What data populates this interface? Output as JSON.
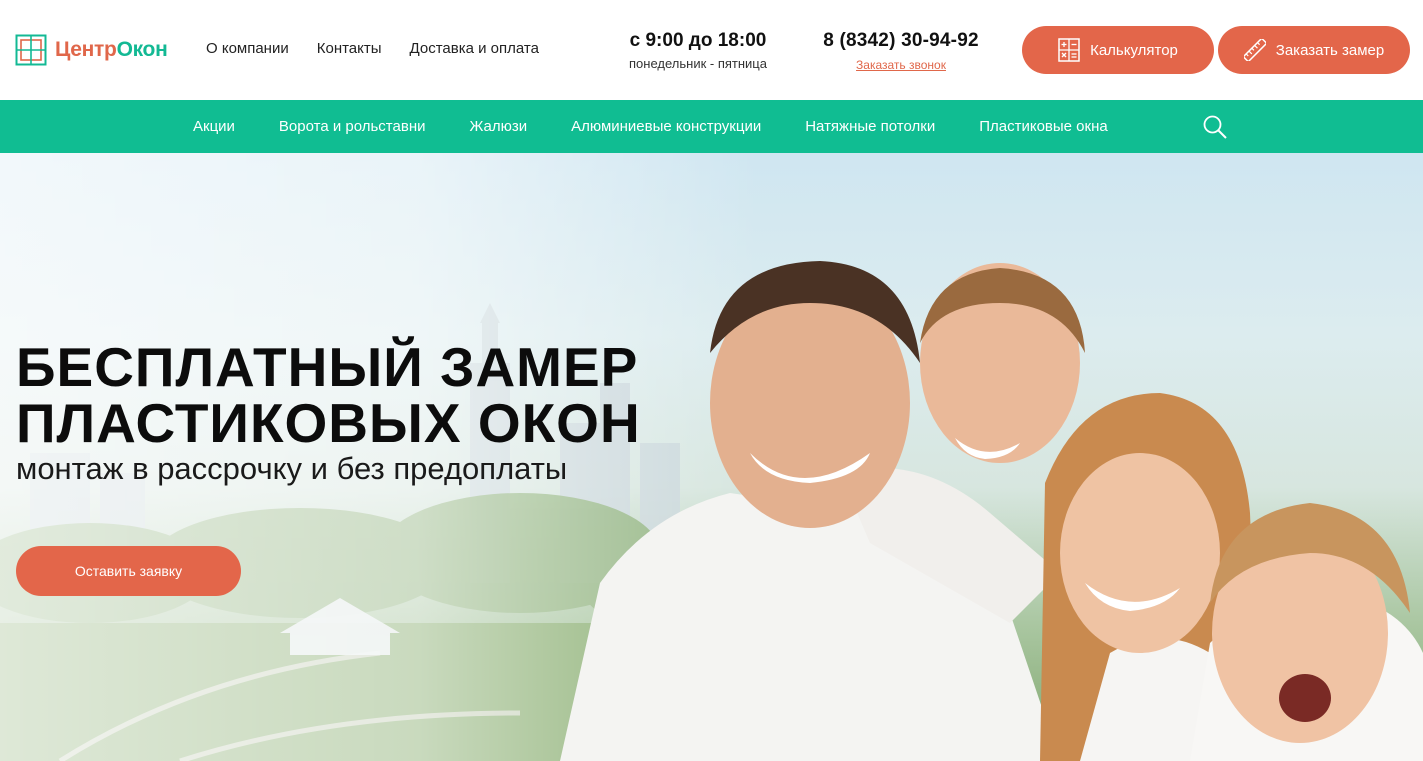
{
  "colors": {
    "accent_orange": "#e3664a",
    "accent_green": "#10bd92"
  },
  "logo": {
    "part1": "Центр",
    "part2": "Окон",
    "icon": "window-icon"
  },
  "top_nav": [
    {
      "label": "О компании"
    },
    {
      "label": "Контакты"
    },
    {
      "label": "Доставка и оплата"
    }
  ],
  "hours": {
    "time": "с 9:00 до 18:00",
    "days": "понедельник - пятница"
  },
  "contact": {
    "phone": "8 (8342) 30-94-92",
    "callback_link": "Заказать звонок"
  },
  "buttons": {
    "calculator": {
      "label": "Калькулятор",
      "icon": "calculator-icon"
    },
    "measure": {
      "label": "Заказать замер",
      "icon": "ruler-icon"
    }
  },
  "main_menu": [
    {
      "label": "Акции"
    },
    {
      "label": "Ворота и рольставни"
    },
    {
      "label": "Жалюзи"
    },
    {
      "label": "Алюминиевые конструкции"
    },
    {
      "label": "Натяжные потолки"
    },
    {
      "label": "Пластиковые окна"
    }
  ],
  "search": {
    "icon": "search-icon"
  },
  "hero": {
    "title_line1": "БЕСПЛАТНЫЙ ЗАМЕР",
    "title_line2": "ПЛАСТИКОВЫХ ОКОН",
    "subtitle": "монтаж в рассрочку и без предоплаты",
    "cta": "Оставить заявку"
  }
}
